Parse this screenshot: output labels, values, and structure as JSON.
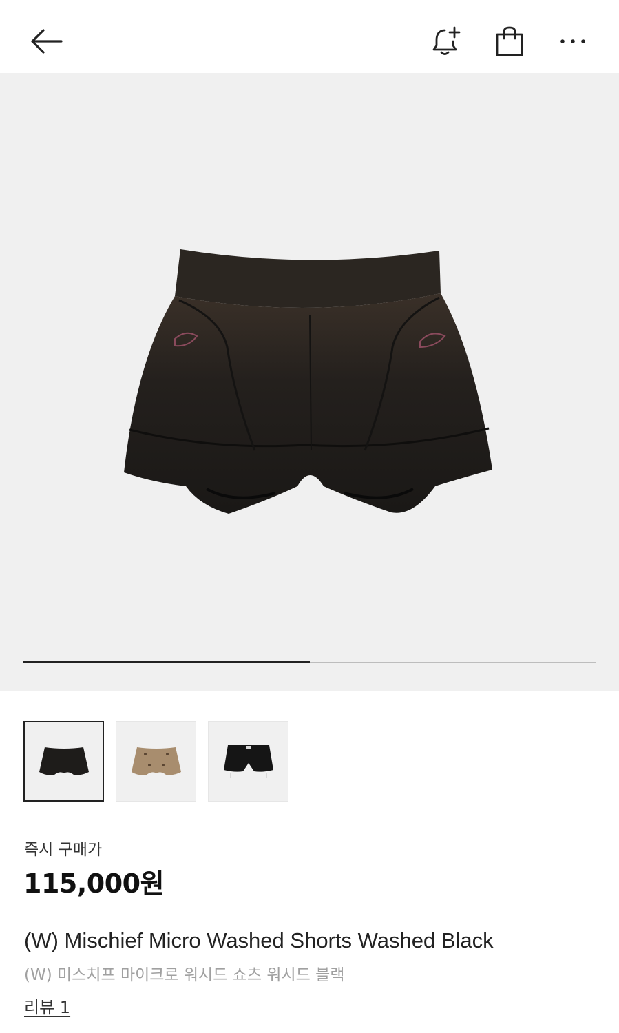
{
  "header": {
    "back_icon": "arrow-left-icon",
    "alarm_icon": "bell-plus-icon",
    "bag_icon": "shopping-bag-icon",
    "more_icon": "more-horizontal-icon"
  },
  "gallery": {
    "progress_fraction": 0.5,
    "thumbnails": [
      {
        "name": "black-shorts",
        "selected": true
      },
      {
        "name": "beige-shorts",
        "selected": false
      },
      {
        "name": "black-shorts-side-hardware",
        "selected": false
      }
    ]
  },
  "pricing": {
    "label": "즉시 구매가",
    "price": "115,000원"
  },
  "product": {
    "title_en": "(W) Mischief Micro Washed Shorts Washed Black",
    "title_ko": "(W) 미스치프 마이크로 워시드 쇼츠 워시드 블랙",
    "reviews": "리뷰 1"
  },
  "colors": {
    "hero_bg": "#f0f0f0",
    "text_primary": "#222222",
    "text_secondary": "#a0a0a0",
    "shorts_black": "#1e1c1a",
    "shorts_beige": "#a88d6e"
  }
}
